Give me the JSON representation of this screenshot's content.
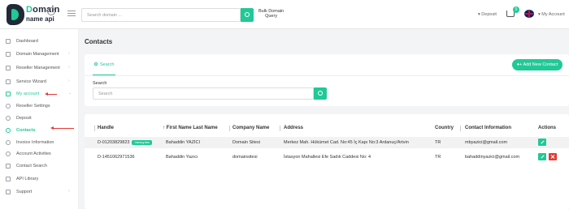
{
  "topbar": {
    "logo_line1_a": "D",
    "logo_line1_b": "omain",
    "logo_line2": "name api",
    "search_placeholder": "Search domain ...",
    "bulk_line1": "Bulk Domain",
    "bulk_line2": "Query",
    "deposit": "Deposit",
    "cart_count": "0",
    "account": "My Account"
  },
  "sidebar": {
    "items": [
      {
        "label": "Dashboard"
      },
      {
        "label": "Domain Management"
      },
      {
        "label": "Reseller Management"
      },
      {
        "label": "Service Wizard"
      },
      {
        "label": "My account"
      },
      {
        "label": "Reseller Settings"
      },
      {
        "label": "Deposit"
      },
      {
        "label": "Contacts"
      },
      {
        "label": "Invoice Information"
      },
      {
        "label": "Account Activities"
      },
      {
        "label": "Contact Search"
      },
      {
        "label": "API Library"
      },
      {
        "label": "Support"
      }
    ]
  },
  "main": {
    "title": "Contacts",
    "search_tab": "Search",
    "add_button": "Add New Contact",
    "search_label": "Search",
    "search_placeholder": "Search"
  },
  "table": {
    "headers": [
      "Handle",
      "First Name Last Name",
      "Company Name",
      "Address",
      "Country",
      "Contact Information",
      "Actions"
    ],
    "rows": [
      {
        "handle": "D-01203829823",
        "badge": "Varsayılan",
        "name": "Bahaddin YAZICI",
        "company": "Domain Sitesi",
        "address": "Merkez Mah. Hükümet Cad. No:45 İç Kapı No:3 Ardanuç/Artvin",
        "country": "TR",
        "contact": "mbyazici@gmail.com"
      },
      {
        "handle": "D-1451062971536",
        "badge": "",
        "name": "Bahaddin Yazıcı",
        "company": "domainsitesi",
        "address": "İstasyon Mahallesi Efe Sadık Caddesi No: 4",
        "country": "TR",
        "contact": "bahaddinyazici@gmail.com"
      }
    ]
  }
}
